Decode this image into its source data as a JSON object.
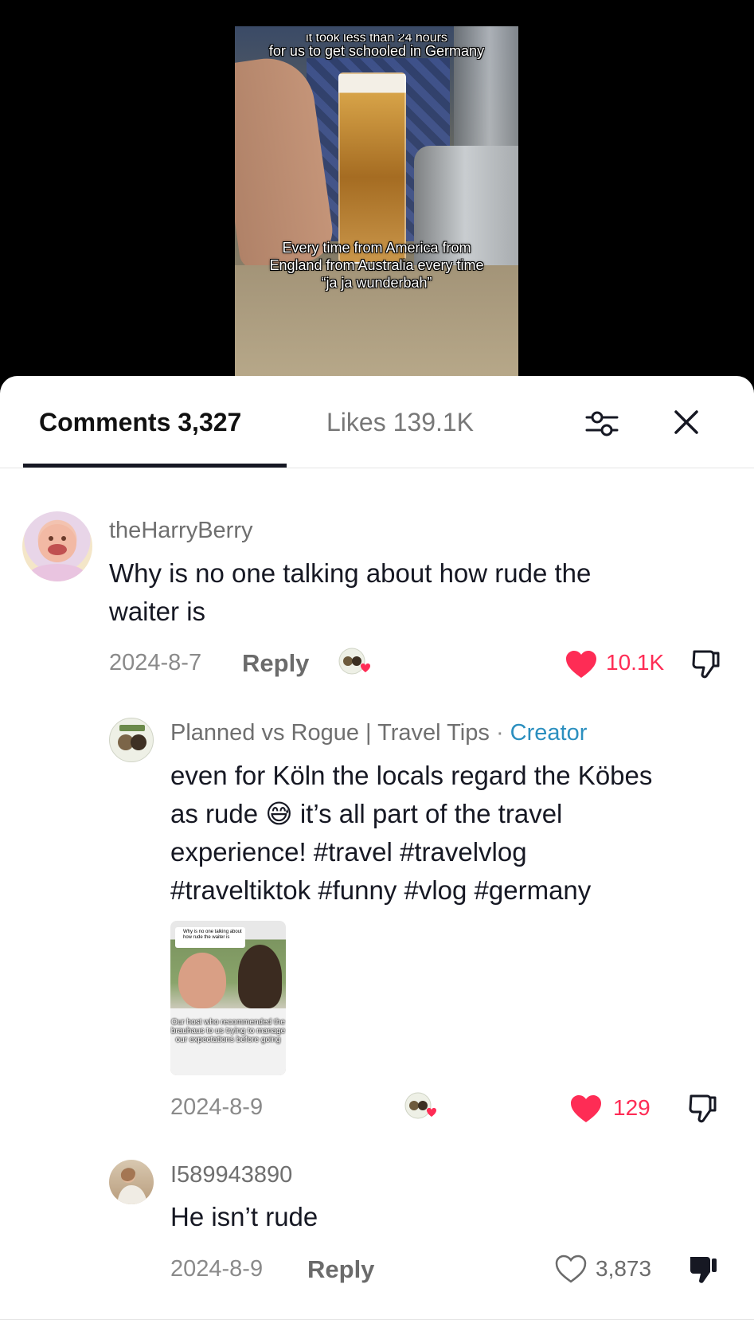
{
  "video": {
    "caption_top_cut": "it took less than 24 hours",
    "caption_top": "for us to get schooled in Germany",
    "caption_bottom": "Every time from America from England from Australia every time “ja ja wunderbah”"
  },
  "tabs": {
    "comments": "Comments 3,327",
    "likes": "Likes 139.1K"
  },
  "icons": {
    "filter": "filter-sliders-icon",
    "close": "close-icon",
    "like_filled": "heart-filled-icon",
    "like_outline": "heart-outline-icon",
    "dislike": "thumbs-down-icon"
  },
  "colors": {
    "like_red": "#fe2c55",
    "creator_blue": "#2b8fbf"
  },
  "comments": [
    {
      "username": "theHarryBerry",
      "text_line1": "Why is no one talking about how rude the",
      "text_line2": "waiter is",
      "date": "2024-8-7",
      "reply": "Reply",
      "likes": "10.1K",
      "liked": true
    },
    {
      "username": "Planned vs Rogue | Travel Tips",
      "separator": "·",
      "tag": "Creator",
      "text_line1": "even for Köln the locals regard the Köbes",
      "text_line2a": "as rude",
      "emoji": "😅",
      "text_line2b": "it’s all part of the travel",
      "text_line3": "experience! #travel #travelvlog",
      "text_line4": "#traveltiktok #funny #vlog #germany",
      "attachment_caption_top": "Why is no one talking about how rude the waiter is",
      "attachment_caption": "Our host who recommended the brauhaus to us trying to manage our expectations before going",
      "date": "2024-8-9",
      "likes": "129",
      "liked": true
    },
    {
      "username": "I589943890",
      "text_line1": "He isn’t rude",
      "date": "2024-8-9",
      "reply": "Reply",
      "likes": "3,873",
      "liked": false
    }
  ]
}
